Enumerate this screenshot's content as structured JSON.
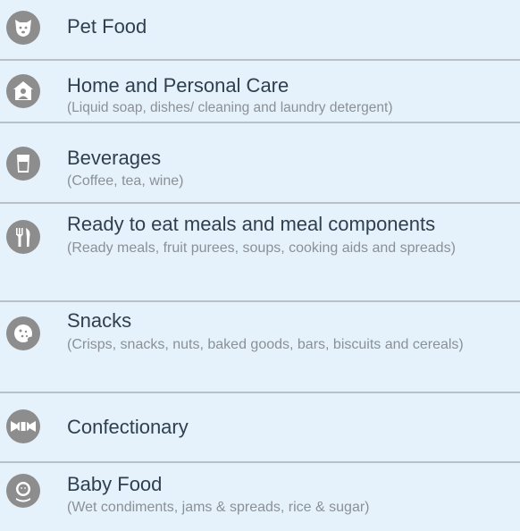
{
  "categories": [
    {
      "title": "Pet Food",
      "subtitle": "",
      "icon": "dog-icon"
    },
    {
      "title": "Home and Personal Care",
      "subtitle": "(Liquid soap, dishes/ cleaning and laundry detergent)",
      "icon": "house-person-icon"
    },
    {
      "title": "Beverages",
      "subtitle": "(Coffee, tea, wine)",
      "icon": "glass-icon"
    },
    {
      "title": "Ready to eat meals and meal components",
      "subtitle": "(Ready meals, fruit purees, soups, cooking aids and spreads)",
      "icon": "fork-knife-icon"
    },
    {
      "title": "Snacks",
      "subtitle": "(Crisps, snacks, nuts, baked goods, bars, biscuits and cereals)",
      "icon": "cookie-icon"
    },
    {
      "title": "Confectionary",
      "subtitle": "",
      "icon": "candy-icon"
    },
    {
      "title": "Baby Food",
      "subtitle": "(Wet condiments, jams & spreads, rice & sugar)",
      "icon": "baby-icon"
    }
  ]
}
